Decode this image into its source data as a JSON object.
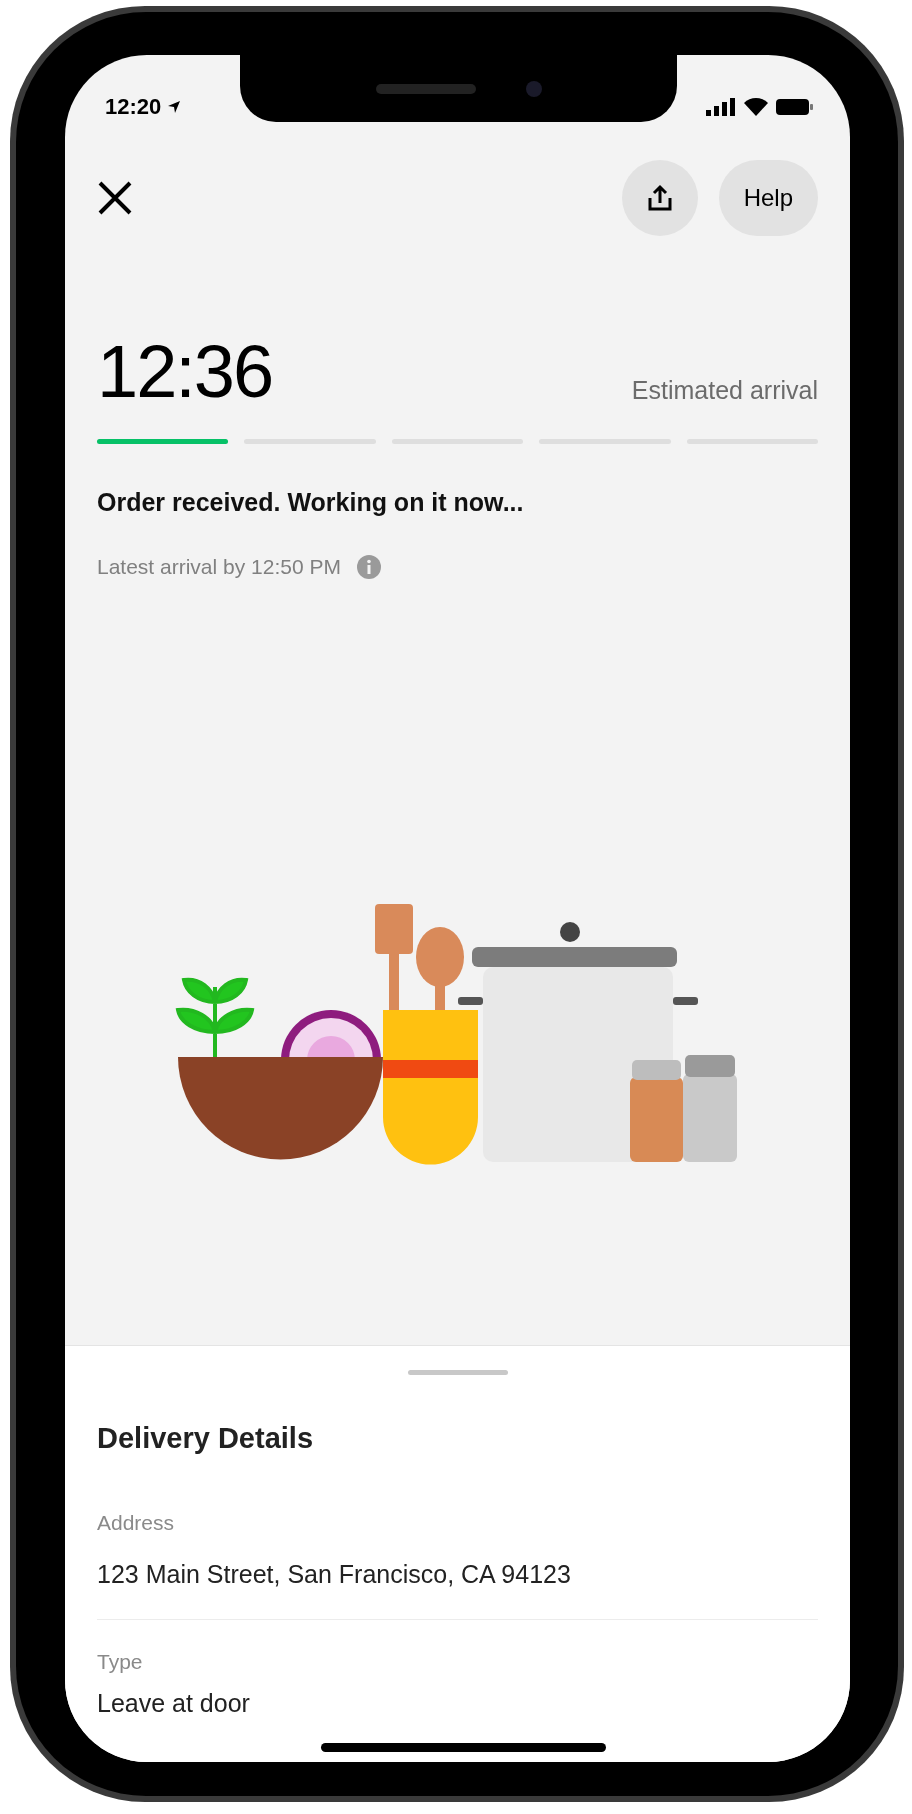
{
  "status_bar": {
    "time": "12:20"
  },
  "header": {
    "help_button": "Help"
  },
  "eta": {
    "time": "12:36",
    "label": "Estimated arrival"
  },
  "progress": [
    {
      "level": 1
    },
    {
      "level": 0
    },
    {
      "level": 0
    },
    {
      "level": 0
    },
    {
      "level": 0
    }
  ],
  "status": {
    "headline": "Order received. Working on it now...",
    "detail": "Latest arrival by 12:50 PM"
  },
  "delivery_details": {
    "title": "Delivery Details",
    "fields": [
      {
        "label": "Address",
        "value": "123 Main Street, San Francisco, CA 94123"
      },
      {
        "label": "Type",
        "value": "Leave at door"
      }
    ]
  }
}
